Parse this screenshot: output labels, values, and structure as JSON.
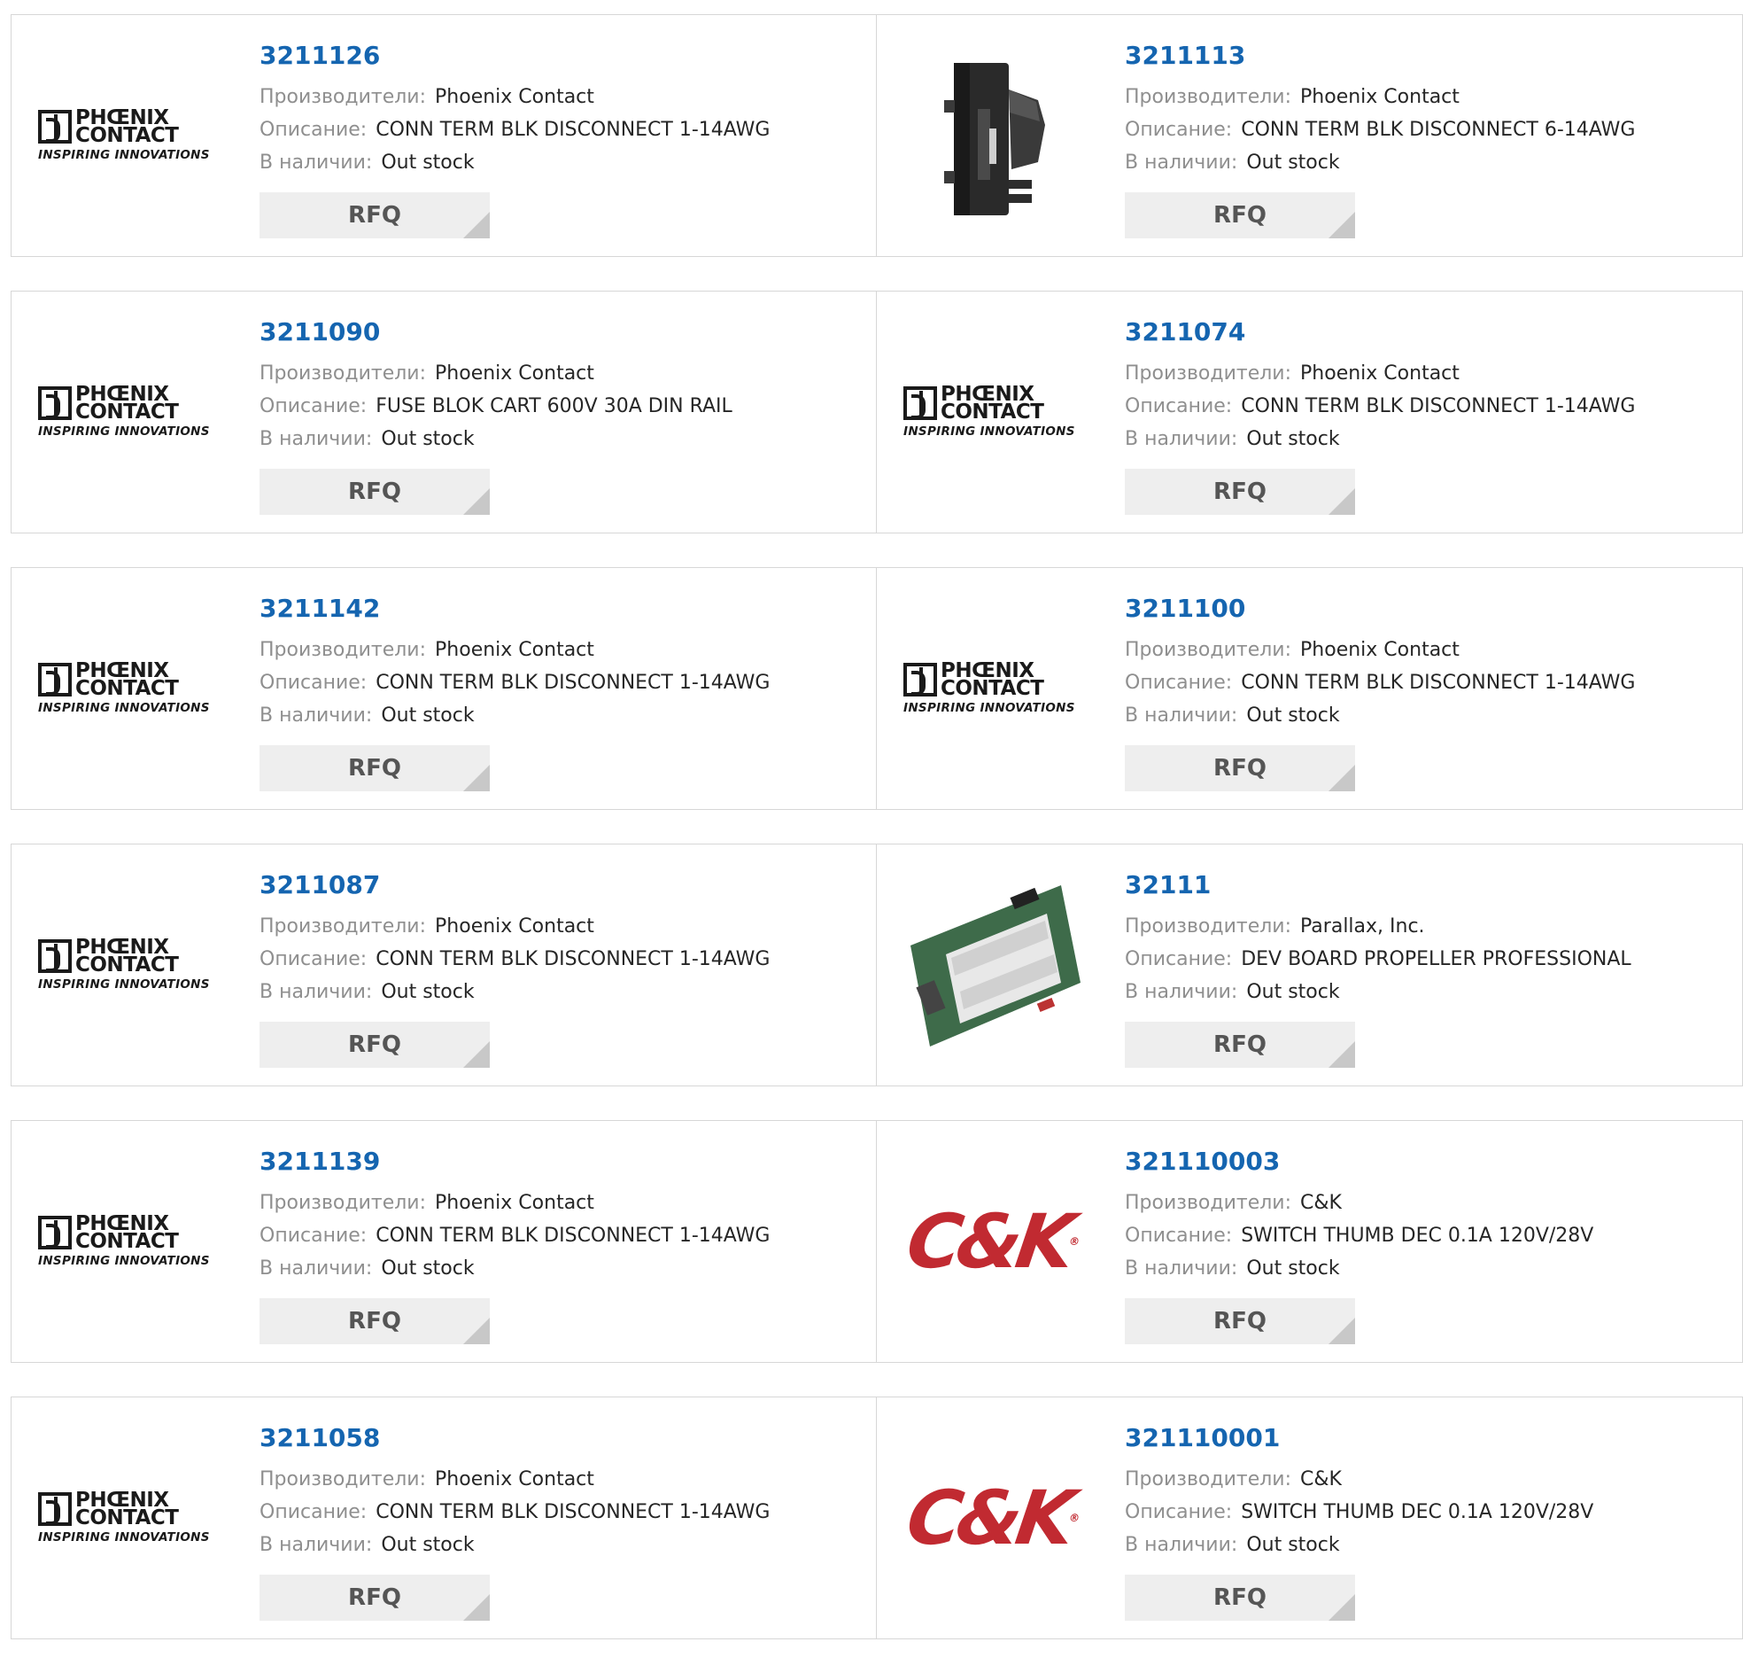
{
  "labels": {
    "manufacturer": "Производители:",
    "description": "Описание:",
    "stock": "В наличии:",
    "rfq": "RFQ"
  },
  "logos": {
    "phoenix_top": "PHŒNIX",
    "phoenix_mid": "CONTACT",
    "phoenix_tag": "INSPIRING INNOVATIONS",
    "ck": "C&K",
    "ck_mark": "®"
  },
  "products": [
    {
      "part": "3211126",
      "manufacturer": "Phoenix Contact",
      "description": "CONN TERM BLK DISCONNECT 1-14AWG",
      "stock": "Out stock",
      "image": "phoenix-logo"
    },
    {
      "part": "3211113",
      "manufacturer": "Phoenix Contact",
      "description": "CONN TERM BLK DISCONNECT 6-14AWG",
      "stock": "Out stock",
      "image": "fuse-holder-photo"
    },
    {
      "part": "3211090",
      "manufacturer": "Phoenix Contact",
      "description": "FUSE BLOK CART 600V 30A DIN RAIL",
      "stock": "Out stock",
      "image": "phoenix-logo"
    },
    {
      "part": "3211074",
      "manufacturer": "Phoenix Contact",
      "description": "CONN TERM BLK DISCONNECT 1-14AWG",
      "stock": "Out stock",
      "image": "phoenix-logo"
    },
    {
      "part": "3211142",
      "manufacturer": "Phoenix Contact",
      "description": "CONN TERM BLK DISCONNECT 1-14AWG",
      "stock": "Out stock",
      "image": "phoenix-logo"
    },
    {
      "part": "3211100",
      "manufacturer": "Phoenix Contact",
      "description": "CONN TERM BLK DISCONNECT 1-14AWG",
      "stock": "Out stock",
      "image": "phoenix-logo"
    },
    {
      "part": "3211087",
      "manufacturer": "Phoenix Contact",
      "description": "CONN TERM BLK DISCONNECT 1-14AWG",
      "stock": "Out stock",
      "image": "phoenix-logo"
    },
    {
      "part": "32111",
      "manufacturer": "Parallax, Inc.",
      "description": "DEV BOARD PROPELLER PROFESSIONAL",
      "stock": "Out stock",
      "image": "dev-board-photo"
    },
    {
      "part": "3211139",
      "manufacturer": "Phoenix Contact",
      "description": "CONN TERM BLK DISCONNECT 1-14AWG",
      "stock": "Out stock",
      "image": "phoenix-logo"
    },
    {
      "part": "321110003",
      "manufacturer": "C&K",
      "description": "SWITCH THUMB DEC 0.1A 120V/28V",
      "stock": "Out stock",
      "image": "ck-logo"
    },
    {
      "part": "3211058",
      "manufacturer": "Phoenix Contact",
      "description": "CONN TERM BLK DISCONNECT 1-14AWG",
      "stock": "Out stock",
      "image": "phoenix-logo"
    },
    {
      "part": "321110001",
      "manufacturer": "C&K",
      "description": "SWITCH THUMB DEC 0.1A 120V/28V",
      "stock": "Out stock",
      "image": "ck-logo"
    }
  ],
  "colors": {
    "part_link": "#1565b0",
    "label": "#8f8f8f",
    "value": "#262626",
    "rfq_bg": "#eeeeee",
    "ck_red": "#c12a31"
  }
}
